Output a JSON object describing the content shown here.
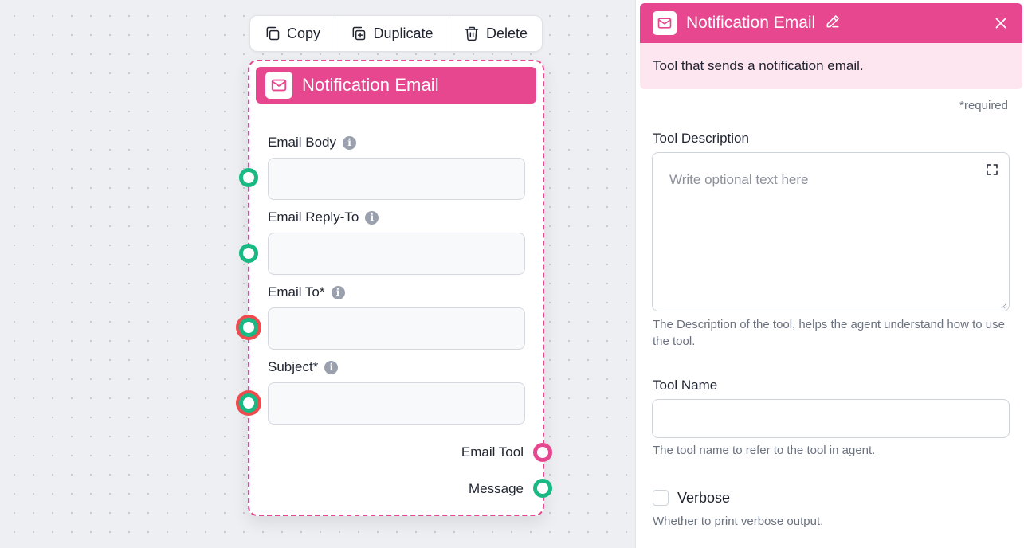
{
  "toolbar": {
    "copy_label": "Copy",
    "duplicate_label": "Duplicate",
    "delete_label": "Delete"
  },
  "node": {
    "title": "Notification Email",
    "icon": "mail-icon",
    "fields": [
      {
        "label": "Email Body",
        "value": "",
        "required": false
      },
      {
        "label": "Email Reply-To",
        "value": "",
        "required": false
      },
      {
        "label": "Email To*",
        "value": "",
        "required": true
      },
      {
        "label": "Subject*",
        "value": "",
        "required": true
      }
    ],
    "outputs": [
      {
        "label": "Email Tool",
        "color": "#e7478f"
      },
      {
        "label": "Message",
        "color": "#18b983"
      }
    ]
  },
  "panel": {
    "title": "Notification Email",
    "description": "Tool that sends a notification email.",
    "required_note": "*required",
    "tool_description": {
      "label": "Tool Description",
      "placeholder": "Write optional text here",
      "help": "The Description of the tool, helps the agent understand how to use the tool."
    },
    "tool_name": {
      "label": "Tool Name",
      "value": "",
      "help": "The tool name to refer to the tool in agent."
    },
    "verbose": {
      "label": "Verbose",
      "checked": false,
      "help": "Whether to print verbose output."
    }
  },
  "colors": {
    "accent": "#e7478f",
    "handle_green": "#18b983",
    "required_red": "#ef4b4f"
  }
}
